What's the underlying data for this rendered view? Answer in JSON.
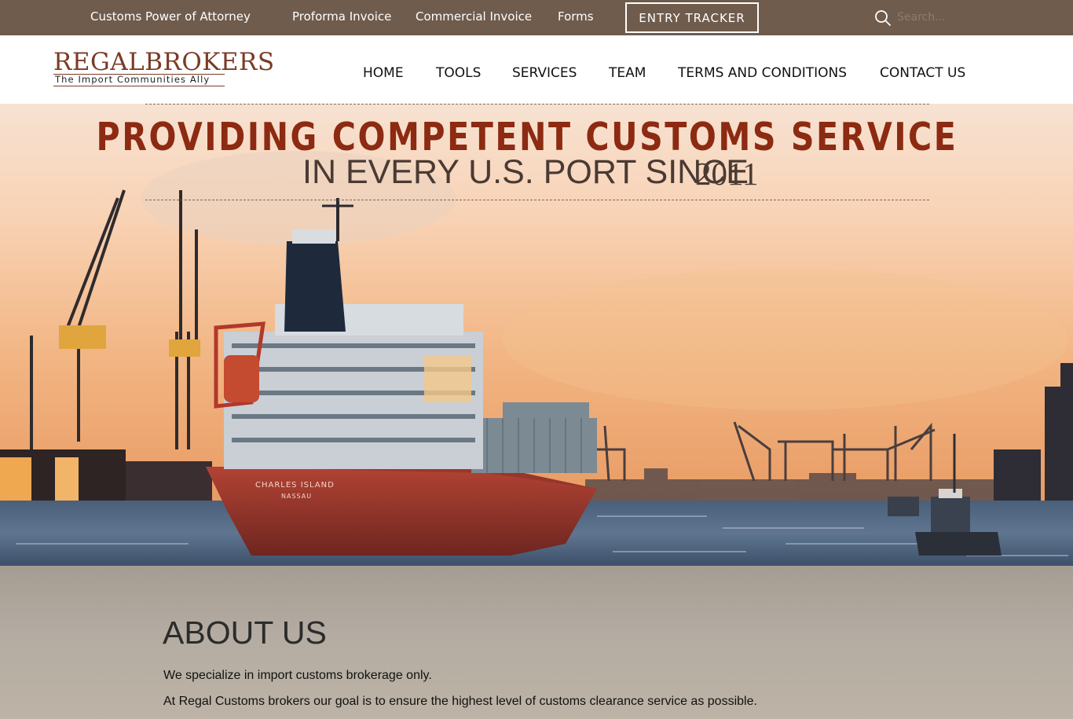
{
  "topbar": {
    "links": [
      "Customs Power of Attorney",
      "Proforma Invoice",
      "Commercial Invoice",
      "Forms"
    ],
    "tracker_label": "ENTRY TRACKER",
    "search_placeholder": "Search..."
  },
  "logo": {
    "name_first": "REGAL",
    "name_second": "BROKERS",
    "tagline": "The Import Communities Ally"
  },
  "nav": {
    "items": [
      "HOME",
      "TOOLS",
      "SERVICES",
      "TEAM",
      "TERMS AND CONDITIONS",
      "CONTACT US"
    ]
  },
  "hero": {
    "line1": "PROVIDING COMPETENT CUSTOMS SERVICE",
    "line2": "IN EVERY U.S. PORT SINCE",
    "year": "2011",
    "ship_name": "CHARLES ISLAND",
    "ship_port": "NASSAU"
  },
  "about": {
    "title": "ABOUT US",
    "paragraphs": [
      "We specialize in import customs brokerage only.",
      "At Regal Customs brokers our goal is to ensure the highest level of customs clearance service as possible."
    ]
  },
  "colors": {
    "topbar": "#6f5c4d",
    "brand": "#7a3b26",
    "headline": "#8c2a12"
  }
}
